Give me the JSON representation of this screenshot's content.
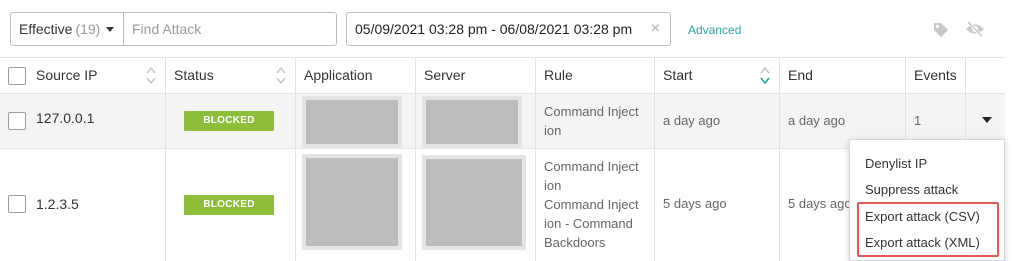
{
  "toolbar": {
    "filter_label": "Effective",
    "filter_count": "(19)",
    "search_placeholder": "Find Attack",
    "date_range": "05/09/2021 03:28 pm - 06/08/2021 03:28 pm",
    "clear_symbol": "×",
    "advanced_label": "Advanced",
    "icons": [
      "tag-icon",
      "eye-slash-icon"
    ]
  },
  "table": {
    "headers": [
      "Source IP",
      "Status",
      "Application",
      "Server",
      "Rule",
      "Start",
      "End",
      "Events"
    ],
    "sorted_column": "Start",
    "rows": [
      {
        "source_ip": "127.0.0.1",
        "status": "BLOCKED",
        "rule_lines": [
          "Command Inject",
          "ion"
        ],
        "start": "a day ago",
        "end": "a day ago",
        "events": "1"
      },
      {
        "source_ip": "1.2.3.5",
        "status": "BLOCKED",
        "rule_lines": [
          "Command Inject",
          "ion",
          "Command Inject",
          "ion - Command",
          "Backdoors"
        ],
        "start": "5 days ago",
        "end": "5 days ago"
      }
    ]
  },
  "context_menu": {
    "items": [
      "Denylist IP",
      "Suppress attack",
      "Export attack (CSV)",
      "Export attack (XML)"
    ]
  },
  "colors": {
    "status_blocked": "#8cbe3a",
    "link_accent": "#2aa3a3",
    "highlight_box": "#e05a5a"
  }
}
